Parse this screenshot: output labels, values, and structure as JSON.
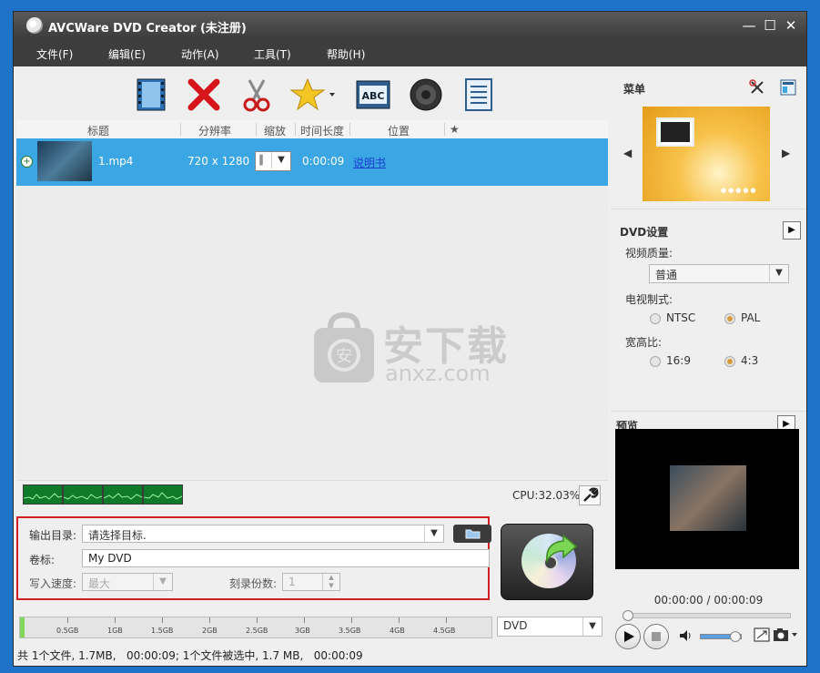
{
  "window": {
    "title": "AVCWare DVD Creator (未注册)",
    "controls": {
      "minimize": "—",
      "maximize": "☐",
      "close": "✕"
    }
  },
  "menu": [
    "文件(F)",
    "编辑(E)",
    "动作(A)",
    "工具(T)",
    "帮助(H)"
  ],
  "toolbar": {
    "buttons": [
      "add-video-icon",
      "delete-icon",
      "cut-icon",
      "effect-icon",
      "subtitle-icon",
      "audio-icon",
      "chapter-icon"
    ]
  },
  "file_list": {
    "columns": [
      "标题",
      "分辨率",
      "缩放",
      "时间长度",
      "位置",
      "★"
    ],
    "rows": [
      {
        "title": "1.mp4",
        "resolution": "720 x 1280",
        "zoom": "∥",
        "duration": "0:00:09",
        "position": "说明书"
      }
    ]
  },
  "watermark": {
    "text": "安下载",
    "subtext": "anxz.com"
  },
  "monitor": {
    "cpu": "CPU:32.03%"
  },
  "output": {
    "dir_label": "输出目录:",
    "dir_placeholder": "请选择目标.",
    "volume_label": "卷标:",
    "volume_value": "My DVD",
    "speed_label": "写入速度:",
    "speed_value": "最大",
    "copies_label": "刻录份数:",
    "copies_value": "1"
  },
  "capacity": {
    "ticks": [
      "0.5GB",
      "1GB",
      "1.5GB",
      "2GB",
      "2.5GB",
      "3GB",
      "3.5GB",
      "4GB",
      "4.5GB"
    ],
    "disc_type": "DVD",
    "used_fraction": 0.01
  },
  "status": "共 1个文件, 1.7MB,   00:00:09; 1个文件被选中, 1.7 MB,   00:00:09",
  "right_panel": {
    "menu_title": "菜单",
    "dvd_settings": {
      "title": "DVD设置",
      "quality_label": "视频质量:",
      "quality_value": "普通",
      "tv_label": "电视制式:",
      "tv_options": [
        "NTSC",
        "PAL"
      ],
      "tv_selected": "PAL",
      "aspect_label": "宽高比:",
      "aspect_options": [
        "16:9",
        "4:3"
      ],
      "aspect_selected": "4:3"
    },
    "preview": {
      "title": "预览",
      "time": "00:00:00 / 00:00:09"
    }
  }
}
